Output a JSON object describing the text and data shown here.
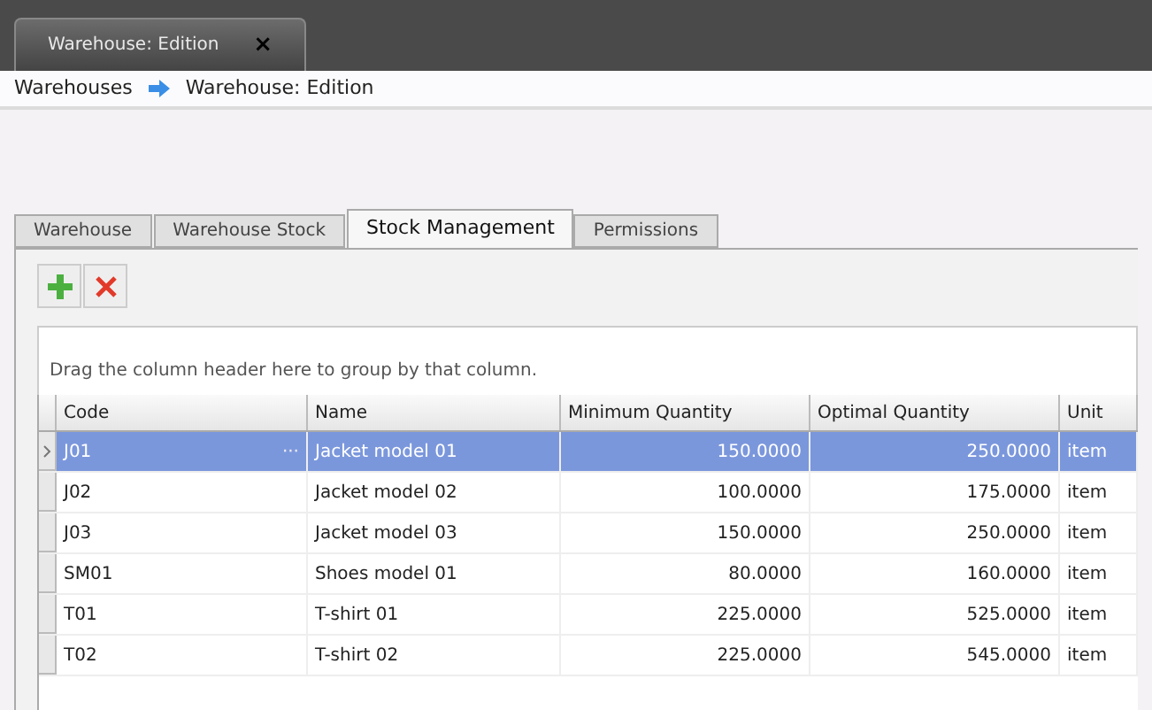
{
  "document_tab": {
    "title": "Warehouse: Edition",
    "close": "×"
  },
  "breadcrumb": [
    "Warehouses",
    "Warehouse: Edition"
  ],
  "tabs": [
    {
      "label": "Warehouse",
      "selected": false
    },
    {
      "label": "Warehouse Stock",
      "selected": false
    },
    {
      "label": "Stock Management",
      "selected": true
    },
    {
      "label": "Permissions",
      "selected": false
    }
  ],
  "group_panel_hint": "Drag the column header here to group by that column.",
  "table": {
    "columns": [
      "Code",
      "Name",
      "Minimum Quantity",
      "Optimal Quantity",
      "Unit"
    ],
    "editor_button": "···",
    "rows": [
      {
        "selected": true,
        "cells": [
          "J01",
          "Jacket model 01",
          "150.0000",
          "250.0000",
          "item"
        ]
      },
      {
        "selected": false,
        "cells": [
          "J02",
          "Jacket model 02",
          "100.0000",
          "175.0000",
          "item"
        ]
      },
      {
        "selected": false,
        "cells": [
          "J03",
          "Jacket model 03",
          "150.0000",
          "250.0000",
          "item"
        ]
      },
      {
        "selected": false,
        "cells": [
          "SM01",
          "Shoes model 01",
          "80.0000",
          "160.0000",
          "item"
        ]
      },
      {
        "selected": false,
        "cells": [
          "T01",
          "T-shirt 01",
          "225.0000",
          "525.0000",
          "item"
        ]
      },
      {
        "selected": false,
        "cells": [
          "T02",
          "T-shirt 02",
          "225.0000",
          "545.0000",
          "item"
        ]
      }
    ]
  }
}
